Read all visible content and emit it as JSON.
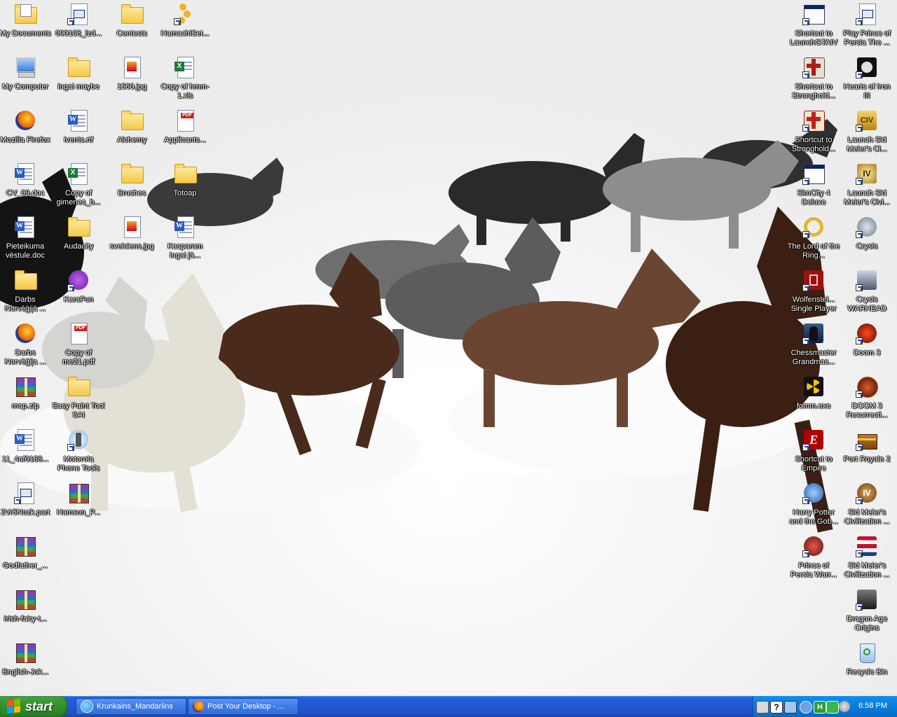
{
  "desktop": {
    "left_icons": [
      {
        "label": "My Documents",
        "icon": "my-documents-icon"
      },
      {
        "label": "090108_lzd...",
        "icon": "app-file-icon"
      },
      {
        "label": "Contests",
        "icon": "folder-icon"
      },
      {
        "label": "HamachiSet...",
        "icon": "hamachi-icon"
      },
      {
        "label": "My Computer",
        "icon": "my-computer-icon"
      },
      {
        "label": "ingai maybe",
        "icon": "folder-icon"
      },
      {
        "label": "1560.jpg",
        "icon": "image-file-icon"
      },
      {
        "label": "Copy of hmm-1.xls",
        "icon": "excel-file-icon"
      },
      {
        "label": "Mozilla Firefox",
        "icon": "firefox-icon"
      },
      {
        "label": "ivents.rtf",
        "icon": "word-file-icon"
      },
      {
        "label": "Alchemy",
        "icon": "folder-icon"
      },
      {
        "label": "Applicants...",
        "icon": "pdf-file-icon"
      },
      {
        "label": "CV_09.doc",
        "icon": "word-file-icon"
      },
      {
        "label": "Copy of gimenes_b...",
        "icon": "excel-file-icon"
      },
      {
        "label": "Brushes",
        "icon": "folder-icon"
      },
      {
        "label": "Totoap",
        "icon": "folder-icon"
      },
      {
        "label": "Pieteikuma vēstule.doc",
        "icon": "word-file-icon"
      },
      {
        "label": "Audacity",
        "icon": "folder-icon"
      },
      {
        "label": "sveiciens.jpg",
        "icon": "image-file-icon"
      },
      {
        "label": "Kasparam ingai jā...",
        "icon": "word-file-icon"
      },
      {
        "label": "Darbs Norvēģijā ...",
        "icon": "folder-icon"
      },
      {
        "label": "KaraFun",
        "icon": "karafun-icon"
      },
      {
        "label": "Darbs Norvēģija ...",
        "icon": "firefox-icon"
      },
      {
        "label": "Copy of me21.pdf",
        "icon": "pdf-file-icon"
      },
      {
        "label": "map.zip",
        "icon": "winrar-icon"
      },
      {
        "label": "Easy Paint Tool SAI",
        "icon": "folder-icon"
      },
      {
        "label": "11_4af0188...",
        "icon": "word-file-icon"
      },
      {
        "label": "Motorola Phone Tools",
        "icon": "motorola-icon"
      },
      {
        "label": "2Vr5Nozk.part",
        "icon": "app-file-icon"
      },
      {
        "label": "Hamsun_P...",
        "icon": "winrar-icon"
      },
      {
        "label": "Godfather_...",
        "icon": "winrar-icon"
      },
      {
        "label": "Irish-fairy-t...",
        "icon": "winrar-icon"
      },
      {
        "label": "English-Jok...",
        "icon": "winrar-icon"
      }
    ],
    "right_icons": [
      {
        "label": "Shortcut to LaunchGTAIV",
        "icon": "app-window-icon"
      },
      {
        "label": "Play Prince of Persia The ...",
        "icon": "app-file-icon"
      },
      {
        "label": "Shortcut to Stronghold...",
        "icon": "stronghold-icon"
      },
      {
        "label": "Hearts of Iron III",
        "icon": "hearts-of-iron-icon"
      },
      {
        "label": "Shortcut to Stronghold...",
        "icon": "stronghold-crusader-icon"
      },
      {
        "label": "Launch Sid Meier's Ci...",
        "icon": "civ-icon"
      },
      {
        "label": "SimCity 4 Deluxe",
        "icon": "app-window-icon"
      },
      {
        "label": "Launch Sid Meier's Civi...",
        "icon": "civ4-icon"
      },
      {
        "label": "The Lord of the Ring...",
        "icon": "ring-icon"
      },
      {
        "label": "Crysis",
        "icon": "crysis-icon"
      },
      {
        "label": "Wolfenstei... Single Player",
        "icon": "wolfenstein-icon"
      },
      {
        "label": "Crysis WARHEAD",
        "icon": "crysis-warhead-icon"
      },
      {
        "label": "Chessmaster Grandmas...",
        "icon": "chess-knight-icon"
      },
      {
        "label": "Doom 3",
        "icon": "doom-icon"
      },
      {
        "label": "fomm.exe",
        "icon": "radiation-icon"
      },
      {
        "label": "DOOM 3 Resurrecti...",
        "icon": "doom-resurrection-icon"
      },
      {
        "label": "Shortcut to Empire",
        "icon": "empire-icon"
      },
      {
        "label": "Port Royale 2",
        "icon": "treasure-chest-icon"
      },
      {
        "label": "Harry Potter and the Gob...",
        "icon": "harry-potter-icon"
      },
      {
        "label": "Sid Meier's Civilization ...",
        "icon": "civ4-colonization-icon"
      },
      {
        "label": "Prince of Persia Warr...",
        "icon": "prince-of-persia-icon"
      },
      {
        "label": "Sid Meier's Civilization ...",
        "icon": "civ4-flag-icon"
      },
      {
        "label": "Dragon Age Origins",
        "icon": "dragon-age-icon"
      },
      {
        "label": "Recycle Bin",
        "icon": "recycle-bin-icon"
      }
    ]
  },
  "taskbar": {
    "start_label": "start",
    "tasks": [
      {
        "label": "Krunkains_Mandariins",
        "icon": "skype-icon"
      },
      {
        "label": "Post Your Desktop - ...",
        "icon": "firefox-icon"
      }
    ],
    "clock": "6:58 PM"
  },
  "colors": {
    "taskbar_blue": "#245edb",
    "start_green": "#3a9b37",
    "tray_blue": "#0a79d8"
  }
}
